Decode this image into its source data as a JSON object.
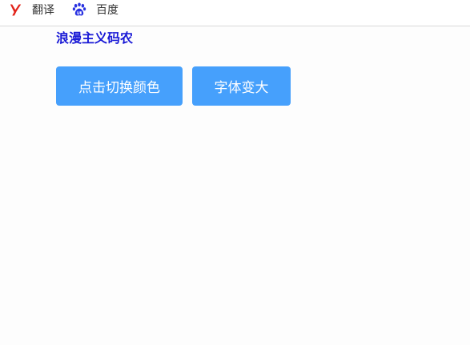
{
  "bookmarks_bar": {
    "items": [
      {
        "label": "翻译",
        "icon": "youdao-y-icon",
        "icon_color": "#e2231a"
      },
      {
        "label": "百度",
        "icon": "baidu-paw-icon",
        "icon_color": "#2932e1"
      }
    ]
  },
  "page": {
    "title": "浪漫主义码农",
    "title_color": "#1a1ad6",
    "buttons": {
      "change_color_label": "点击切换颜色",
      "enlarge_font_label": "字体变大"
    },
    "button_color": "#46a0fc"
  }
}
